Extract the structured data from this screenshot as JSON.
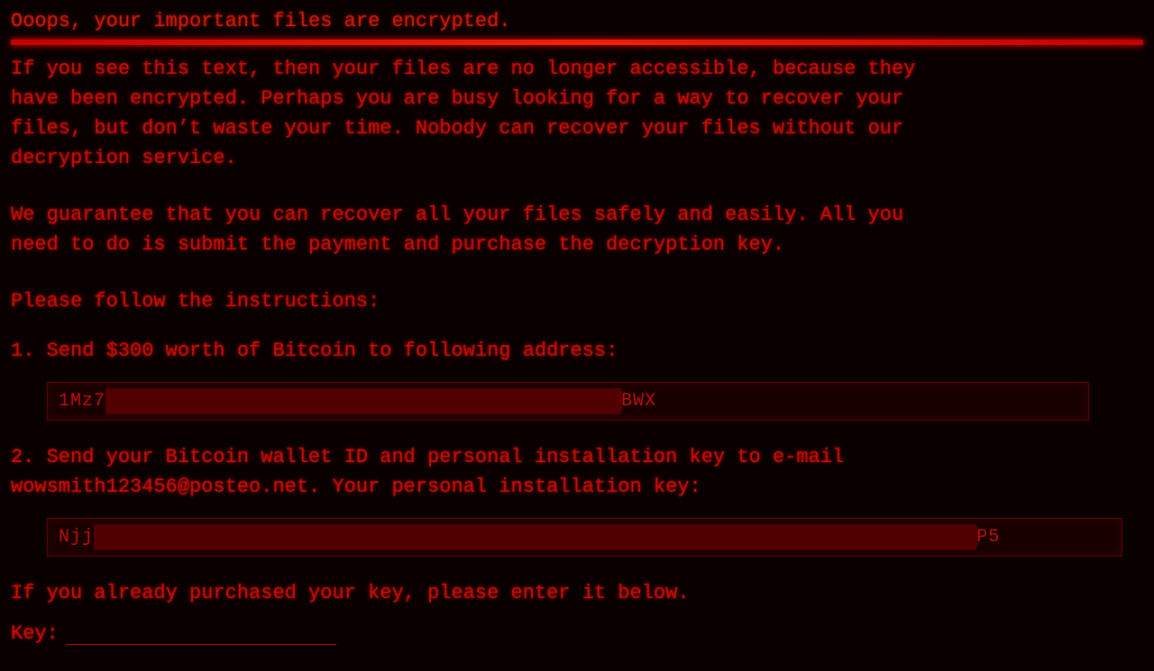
{
  "title": "Ooops, your important files are encrypted.",
  "paragraph1": {
    "line1": "If you see this text, then your files are no longer accessible, because they",
    "line2": "have been encrypted.  Perhaps you are busy looking for a way to recover your",
    "line3": "files, but don’t waste your time.  Nobody can recover your files without our",
    "line4": "decryption service."
  },
  "paragraph2": {
    "line1": "We guarantee that you can recover all your files safely and easily.  All you",
    "line2": "need to do is submit the payment and purchase the decryption key."
  },
  "instructions_header": "Please follow the instructions:",
  "step1": {
    "label": "1. Send $300 worth of Bitcoin to following address:",
    "address_prefix": "1Mz7",
    "address_redacted": "████████████████████████████████████████████████████",
    "address_suffix": "BWX"
  },
  "step2": {
    "label1": "2. Send your Bitcoin wallet ID and personal installation key to e-mail",
    "label2": "   wowsmith123456@posteo.net. Your personal installation key:",
    "key_prefix": "Njj",
    "key_redacted": "█████████████████████████████████████████████████████████████████████████████████████████",
    "key_suffix": "P5"
  },
  "already_purchased": "If you already purchased your key, please enter it below.",
  "key_label": "Key:"
}
